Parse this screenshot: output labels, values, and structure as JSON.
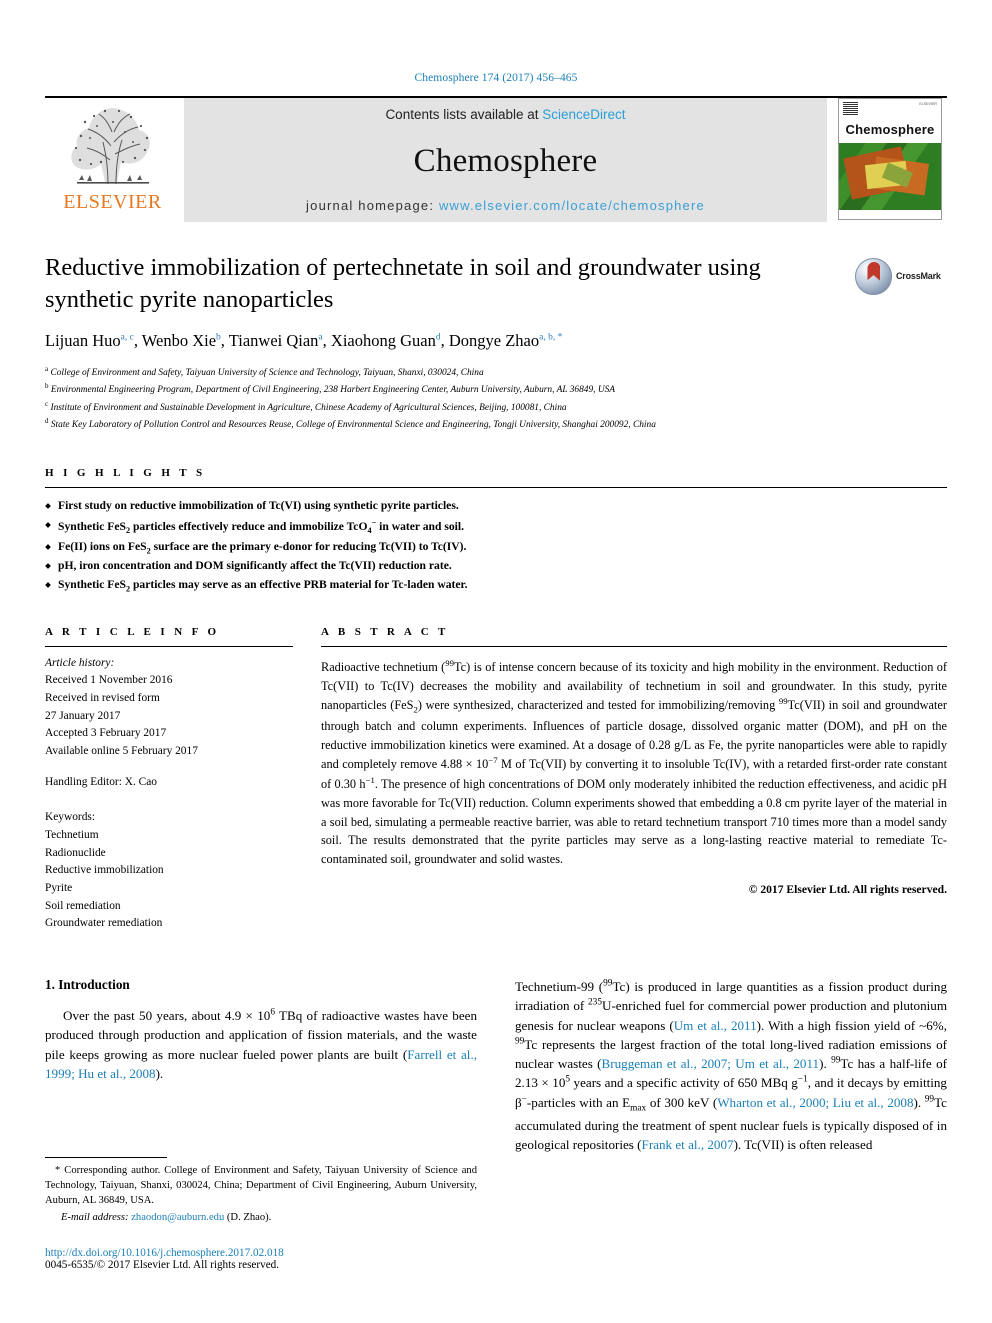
{
  "running_head": "Chemosphere 174 (2017) 456–465",
  "masthead": {
    "publisher": "ELSEVIER",
    "contents_prefix": "Contents lists available at ",
    "contents_link": "ScienceDirect",
    "journal_title": "Chemosphere",
    "homepage_prefix": "journal homepage: ",
    "homepage_url": "www.elsevier.com/locate/chemosphere",
    "cover_title": "Chemosphere",
    "link_color": "#2a9fd6"
  },
  "article": {
    "title": "Reductive immobilization of pertechnetate in soil and groundwater using synthetic pyrite nanoparticles",
    "crossmark_label": "CrossMark",
    "authors_text": "Lijuan Huo a, c, Wenbo Xie b, Tianwei Qian a, Xiaohong Guan d, Dongye Zhao a, b, *",
    "authors": [
      {
        "name": "Lijuan Huo",
        "sup": "a, c"
      },
      {
        "name": "Wenbo Xie",
        "sup": "b"
      },
      {
        "name": "Tianwei Qian",
        "sup": "a"
      },
      {
        "name": "Xiaohong Guan",
        "sup": "d"
      },
      {
        "name": "Dongye Zhao",
        "sup": "a, b, *"
      }
    ],
    "affiliations": [
      {
        "mark": "a",
        "text": "College of Environment and Safety, Taiyuan University of Science and Technology, Taiyuan, Shanxi, 030024, China"
      },
      {
        "mark": "b",
        "text": "Environmental Engineering Program, Department of Civil Engineering, 238 Harbert Engineering Center, Auburn University, Auburn, AL 36849, USA"
      },
      {
        "mark": "c",
        "text": "Institute of Environment and Sustainable Development in Agriculture, Chinese Academy of Agricultural Sciences, Beijing, 100081, China"
      },
      {
        "mark": "d",
        "text": "State Key Laboratory of Pollution Control and Resources Reuse, College of Environmental Science and Engineering, Tongji University, Shanghai 200092, China"
      }
    ]
  },
  "highlights": {
    "label": "H I G H L I G H T S",
    "items": [
      "First study on reductive immobilization of Tc(VI) using synthetic pyrite particles.",
      "Synthetic FeS2 particles effectively reduce and immobilize TcO4− in water and soil.",
      "Fe(II) ions on FeS2 surface are the primary e-donor for reducing Tc(VII) to Tc(IV).",
      "pH, iron concentration and DOM significantly affect the Tc(VII) reduction rate.",
      "Synthetic FeS2 particles may serve as an effective PRB material for Tc-laden water."
    ]
  },
  "article_info": {
    "label": "A R T I C L E   I N F O",
    "history_label": "Article history:",
    "history": [
      "Received 1 November 2016",
      "Received in revised form",
      "27 January 2017",
      "Accepted 3 February 2017",
      "Available online 5 February 2017"
    ],
    "handling_editor": "Handling Editor: X. Cao",
    "keywords_label": "Keywords:",
    "keywords": [
      "Technetium",
      "Radionuclide",
      "Reductive immobilization",
      "Pyrite",
      "Soil remediation",
      "Groundwater remediation"
    ]
  },
  "abstract": {
    "label": "A B S T R A C T",
    "text": "Radioactive technetium (99Tc) is of intense concern because of its toxicity and high mobility in the environment. Reduction of Tc(VII) to Tc(IV) decreases the mobility and availability of technetium in soil and groundwater. In this study, pyrite nanoparticles (FeS2) were synthesized, characterized and tested for immobilizing/removing 99Tc(VII) in soil and groundwater through batch and column experiments. Influences of particle dosage, dissolved organic matter (DOM), and pH on the reductive immobilization kinetics were examined. At a dosage of 0.28 g/L as Fe, the pyrite nanoparticles were able to rapidly and completely remove 4.88 × 10−7 M of Tc(VII) by converting it to insoluble Tc(IV), with a retarded first-order rate constant of 0.30 h−1. The presence of high concentrations of DOM only moderately inhibited the reduction effectiveness, and acidic pH was more favorable for Tc(VII) reduction. Column experiments showed that embedding a 0.8 cm pyrite layer of the material in a soil bed, simulating a permeable reactive barrier, was able to retard technetium transport 710 times more than a model sandy soil. The results demonstrated that the pyrite particles may serve as a long-lasting reactive material to remediate Tc-contaminated soil, groundwater and solid wastes.",
    "copyright": "© 2017 Elsevier Ltd. All rights reserved."
  },
  "introduction": {
    "heading": "1. Introduction",
    "left_paragraph": "Over the past 50 years, about 4.9 × 106 TBq of radioactive wastes have been produced through production and application of fission materials, and the waste pile keeps growing as more nuclear fueled power plants are built (Farrell et al., 1999; Hu et al., 2008).",
    "left_refs": "Farrell et al., 1999; Hu et al., 2008",
    "right_paragraph": "Technetium-99 (99Tc) is produced in large quantities as a fission product during irradiation of 235U-enriched fuel for commercial power production and plutonium genesis for nuclear weapons (Um et al., 2011). With a high fission yield of ~6%, 99Tc represents the largest fraction of the total long-lived radiation emissions of nuclear wastes (Bruggeman et al., 2007; Um et al., 2011). 99Tc has a half-life of 2.13 × 105 years and a specific activity of 650 MBq g−1, and it decays by emitting β−-particles with an Emax of 300 keV (Wharton et al., 2000; Liu et al., 2008). 99Tc accumulated during the treatment of spent nuclear fuels is typically disposed of in geological repositories (Frank et al., 2007). Tc(VII) is often released"
  },
  "footnote": {
    "corresponding": "* Corresponding author. College of Environment and Safety, Taiyuan University of Science and Technology, Taiyuan, Shanxi, 030024, China; Department of Civil Engineering, Auburn University, Auburn, AL 36849, USA.",
    "email_label": "E-mail address:",
    "email": "zhaodon@auburn.edu",
    "email_suffix": "(D. Zhao).",
    "doi": "http://dx.doi.org/10.1016/j.chemosphere.2017.02.018",
    "issn": "0045-6535/© 2017 Elsevier Ltd. All rights reserved."
  }
}
